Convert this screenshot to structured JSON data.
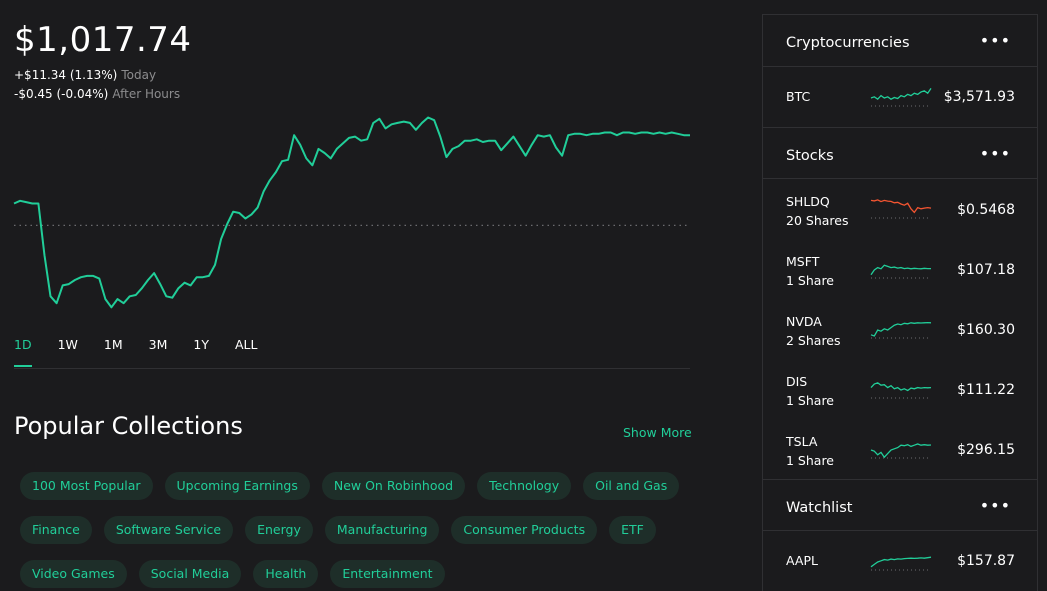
{
  "portfolio": {
    "value": "$1,017.74",
    "today_change": "+$11.34 (1.13%)",
    "today_label": "Today",
    "after_change": "-$0.45 (-0.04%)",
    "after_label": "After Hours",
    "line_color": "#21ce99",
    "chart_series": [
      0.78,
      0.8,
      0.79,
      0.78,
      0.78,
      0.4,
      0.1,
      0.05,
      0.18,
      0.19,
      0.22,
      0.24,
      0.25,
      0.25,
      0.23,
      0.08,
      0.02,
      0.08,
      0.05,
      0.1,
      0.11,
      0.16,
      0.22,
      0.27,
      0.19,
      0.1,
      0.09,
      0.16,
      0.2,
      0.18,
      0.24,
      0.24,
      0.25,
      0.33,
      0.52,
      0.63,
      0.72,
      0.71,
      0.67,
      0.7,
      0.75,
      0.87,
      0.95,
      1.01,
      1.09,
      1.1,
      1.28,
      1.21,
      1.11,
      1.06,
      1.18,
      1.15,
      1.11,
      1.18,
      1.22,
      1.26,
      1.27,
      1.24,
      1.25,
      1.37,
      1.4,
      1.33,
      1.36,
      1.37,
      1.38,
      1.37,
      1.32,
      1.37,
      1.41,
      1.39,
      1.27,
      1.12,
      1.18,
      1.2,
      1.24,
      1.24,
      1.25,
      1.23,
      1.24,
      1.24,
      1.17,
      1.22,
      1.27,
      1.2,
      1.13,
      1.21,
      1.28,
      1.27,
      1.28,
      1.19,
      1.13,
      1.28,
      1.29,
      1.29,
      1.28,
      1.29,
      1.29,
      1.3,
      1.3,
      1.28,
      1.3,
      1.3,
      1.29,
      1.3,
      1.3,
      1.29,
      1.3,
      1.29,
      1.3,
      1.29,
      1.28,
      1.28
    ],
    "chart_baseline": 0.62,
    "ranges": [
      "1D",
      "1W",
      "1M",
      "3M",
      "1Y",
      "ALL"
    ],
    "active_range": "1D"
  },
  "collections": {
    "title": "Popular Collections",
    "show_more": "Show More",
    "rows": [
      [
        "100 Most Popular",
        "Upcoming Earnings",
        "New On Robinhood",
        "Technology",
        "Oil and Gas"
      ],
      [
        "Finance",
        "Software Service",
        "Energy",
        "Manufacturing",
        "Consumer Products",
        "ETF"
      ],
      [
        "Video Games",
        "Social Media",
        "Health",
        "Entertainment"
      ]
    ]
  },
  "sidebar": {
    "more_glyph": "•••",
    "crypto": {
      "title": "Cryptocurrencies",
      "items": [
        {
          "symbol": "BTC",
          "price": "$3,571.93",
          "color": "#21ce99",
          "spark": [
            0.5,
            0.55,
            0.45,
            0.6,
            0.5,
            0.55,
            0.45,
            0.52,
            0.48,
            0.6,
            0.55,
            0.65,
            0.6,
            0.7,
            0.65,
            0.75,
            0.8,
            0.7,
            0.9
          ]
        }
      ]
    },
    "stocks": {
      "title": "Stocks",
      "items": [
        {
          "symbol": "SHLDQ",
          "shares": "20 Shares",
          "price": "$0.5468",
          "color": "#f45531",
          "spark": [
            0.9,
            0.88,
            0.92,
            0.85,
            0.9,
            0.87,
            0.86,
            0.8,
            0.82,
            0.75,
            0.7,
            0.78,
            0.55,
            0.4,
            0.6,
            0.55,
            0.58,
            0.6,
            0.58
          ]
        },
        {
          "symbol": "MSFT",
          "shares": "1 Share",
          "price": "$107.18",
          "color": "#21ce99",
          "spark": [
            0.3,
            0.5,
            0.6,
            0.55,
            0.7,
            0.65,
            0.6,
            0.62,
            0.58,
            0.6,
            0.56,
            0.58,
            0.55,
            0.57,
            0.56,
            0.55,
            0.57,
            0.56,
            0.56
          ]
        },
        {
          "symbol": "NVDA",
          "shares": "2 Shares",
          "price": "$160.30",
          "color": "#21ce99",
          "spark": [
            0.3,
            0.25,
            0.5,
            0.45,
            0.55,
            0.5,
            0.6,
            0.7,
            0.75,
            0.72,
            0.78,
            0.76,
            0.8,
            0.78,
            0.8,
            0.79,
            0.8,
            0.81,
            0.8
          ]
        },
        {
          "symbol": "DIS",
          "shares": "1 Share",
          "price": "$111.22",
          "color": "#21ce99",
          "spark": [
            0.6,
            0.75,
            0.8,
            0.7,
            0.72,
            0.6,
            0.68,
            0.55,
            0.6,
            0.5,
            0.55,
            0.48,
            0.58,
            0.55,
            0.6,
            0.58,
            0.6,
            0.59,
            0.6
          ]
        },
        {
          "symbol": "TSLA",
          "shares": "1 Share",
          "price": "$296.15",
          "color": "#21ce99",
          "spark": [
            0.5,
            0.45,
            0.3,
            0.4,
            0.2,
            0.35,
            0.5,
            0.55,
            0.6,
            0.7,
            0.68,
            0.72,
            0.65,
            0.7,
            0.75,
            0.7,
            0.72,
            0.7,
            0.71
          ]
        }
      ]
    },
    "watchlist": {
      "title": "Watchlist",
      "items": [
        {
          "symbol": "AAPL",
          "price": "$157.87",
          "color": "#21ce99",
          "spark": [
            0.3,
            0.4,
            0.5,
            0.55,
            0.6,
            0.58,
            0.62,
            0.6,
            0.63,
            0.62,
            0.64,
            0.65,
            0.66,
            0.65,
            0.66,
            0.67,
            0.66,
            0.68,
            0.7
          ]
        }
      ]
    }
  }
}
